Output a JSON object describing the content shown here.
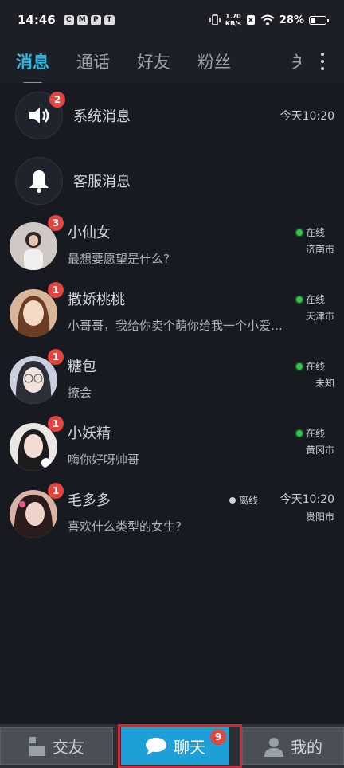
{
  "status_bar": {
    "time": "14:46",
    "net_speed_value": "1.70",
    "net_speed_unit": "KB/s",
    "battery": "28%",
    "app_icons": [
      "C",
      "M",
      "P",
      "T"
    ]
  },
  "tabs": [
    {
      "label": "消息",
      "active": true
    },
    {
      "label": "通话",
      "active": false
    },
    {
      "label": "好友",
      "active": false
    },
    {
      "label": "粉丝",
      "active": false
    }
  ],
  "tab_overflow_glyph": "关",
  "system_rows": [
    {
      "title": "系统消息",
      "badge": "2",
      "time": "今天10:20",
      "icon": "speaker-icon"
    },
    {
      "title": "客服消息",
      "badge": "",
      "time": "",
      "icon": "bell-icon"
    }
  ],
  "chats": [
    {
      "name": "小仙女",
      "message": "最想要愿望是什么?",
      "badge": "3",
      "status": "在线",
      "online": true,
      "city": "济南市",
      "time": "",
      "avatar_colors": [
        "#d8d2cf",
        "#6e6862"
      ]
    },
    {
      "name": "撒娇桃桃",
      "message": "小哥哥，我给你卖个萌你给我一个小爱心吧",
      "badge": "1",
      "status": "在线",
      "online": true,
      "city": "天津市",
      "time": "",
      "avatar_colors": [
        "#f0d2b8",
        "#7b4d30"
      ]
    },
    {
      "name": "糖包",
      "message": "撩会",
      "badge": "1",
      "status": "在线",
      "online": true,
      "city": "未知",
      "time": "",
      "avatar_colors": [
        "#d7dbe8",
        "#4a5568"
      ]
    },
    {
      "name": "小妖精",
      "message": "嗨你好呀帅哥",
      "badge": "1",
      "status": "在线",
      "online": true,
      "city": "黄冈市",
      "time": "",
      "avatar_colors": [
        "#e8e4e2",
        "#2b2b2b"
      ]
    },
    {
      "name": "毛多多",
      "message": "喜欢什么类型的女生?",
      "badge": "1",
      "status": "离线",
      "online": false,
      "city": "贵阳市",
      "time": "今天10:20",
      "avatar_colors": [
        "#e0c0b6",
        "#3b2a2a"
      ]
    }
  ],
  "bottom_nav": {
    "left": {
      "label": "交友",
      "icon": "grid-icon"
    },
    "middle": {
      "label": "聊天",
      "icon": "chat-bubble-icon",
      "badge": "9"
    },
    "right": {
      "label": "我的",
      "icon": "person-icon"
    }
  },
  "colors": {
    "accent": "#2fb7df",
    "badge": "#e2453f",
    "nav_active": "#1d9fd8",
    "highlight_border": "#d9262b"
  }
}
